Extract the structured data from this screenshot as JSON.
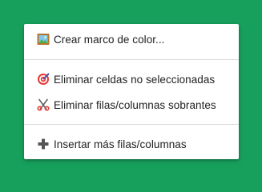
{
  "menu": {
    "items": [
      {
        "label": "Crear marco de color...",
        "icon": "framed-picture-icon"
      },
      {
        "label": "Eliminar celdas no seleccionadas",
        "icon": "target-icon"
      },
      {
        "label": "Eliminar filas/columnas sobrantes",
        "icon": "scissors-icon"
      },
      {
        "label": "Insertar más filas/columnas",
        "icon": "plus-icon"
      }
    ]
  },
  "colors": {
    "background": "#17a05c",
    "menu_background": "#ffffff",
    "text": "#202124",
    "divider": "#dadce0"
  }
}
